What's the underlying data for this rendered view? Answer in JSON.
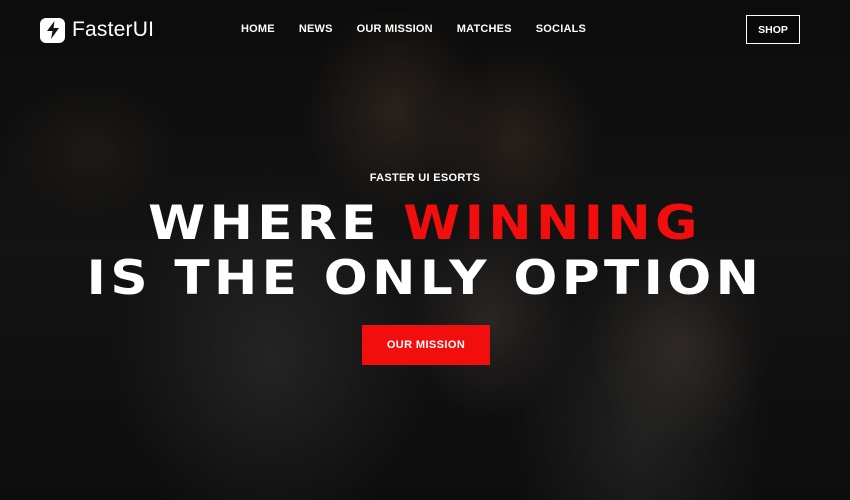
{
  "brand": {
    "name": "FasterUI",
    "icon": "lightning-bolt-icon"
  },
  "nav": {
    "items": [
      {
        "label": "HOME"
      },
      {
        "label": "NEWS"
      },
      {
        "label": "OUR MISSION"
      },
      {
        "label": "MATCHES"
      },
      {
        "label": "SOCIALS"
      }
    ],
    "shop_label": "SHOP"
  },
  "hero": {
    "eyebrow": "FASTER UI ESORTS",
    "headline_part1": "WHERE ",
    "headline_accent": "WINNING",
    "headline_part2": "IS THE ONLY OPTION",
    "cta_label": "OUR MISSION"
  },
  "colors": {
    "accent": "#f30e0e",
    "text": "#ffffff",
    "background": "#141414"
  }
}
